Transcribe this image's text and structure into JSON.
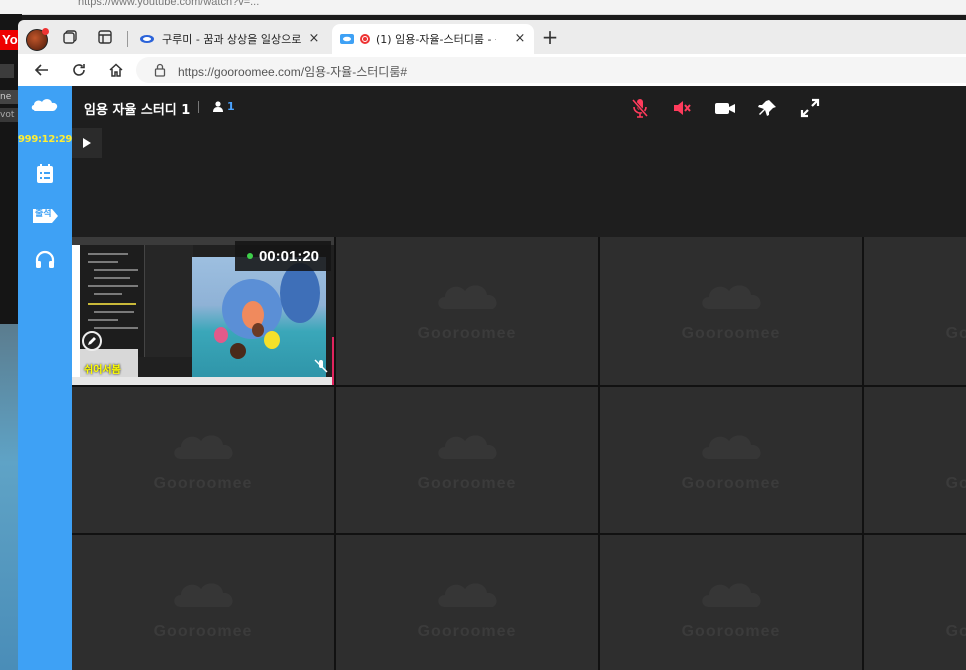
{
  "background": {
    "url_fragment": "https://www.youtube.com/watch?v=...",
    "left_app_badge": "Yo",
    "left_labels": [
      "ne",
      "vot"
    ]
  },
  "browser": {
    "tabs": [
      {
        "title": "구루미 - 꿈과 상상을 일상으로",
        "active": false,
        "close": "×"
      },
      {
        "title": "(1) 임용-자율-스터디룸 - 구",
        "active": true,
        "close": "×",
        "recording": true
      }
    ],
    "new_tab": "+",
    "address": "https://gooroomee.com/임용-자율-스터디룸#"
  },
  "sidebar": {
    "timer": "999:12:29",
    "items": [
      {
        "icon": "schedule-list-icon"
      },
      {
        "icon": "attendance-tag-icon",
        "label": "출석"
      },
      {
        "icon": "headphones-icon"
      }
    ]
  },
  "header": {
    "room_title": "임용 자율 스터디 1",
    "participant_count": "1",
    "controls": [
      {
        "icon": "mic-muted-icon",
        "color": "#ff3b5c"
      },
      {
        "icon": "speaker-muted-icon",
        "color": "#ff3b5c"
      },
      {
        "icon": "camera-icon",
        "color": "#ffffff"
      },
      {
        "icon": "pin-icon",
        "color": "#ffffff"
      },
      {
        "icon": "fullscreen-icon",
        "color": "#ffffff"
      }
    ]
  },
  "grid": {
    "watermark": "Gooroomee",
    "live_cell": {
      "elapsed": "00:01:20",
      "cam_label": "쉬어서봄"
    }
  },
  "colors": {
    "sidebar": "#3ea1f5",
    "timer": "#ffee33",
    "muted": "#ff3b5c",
    "count": "#4aa3ff"
  }
}
